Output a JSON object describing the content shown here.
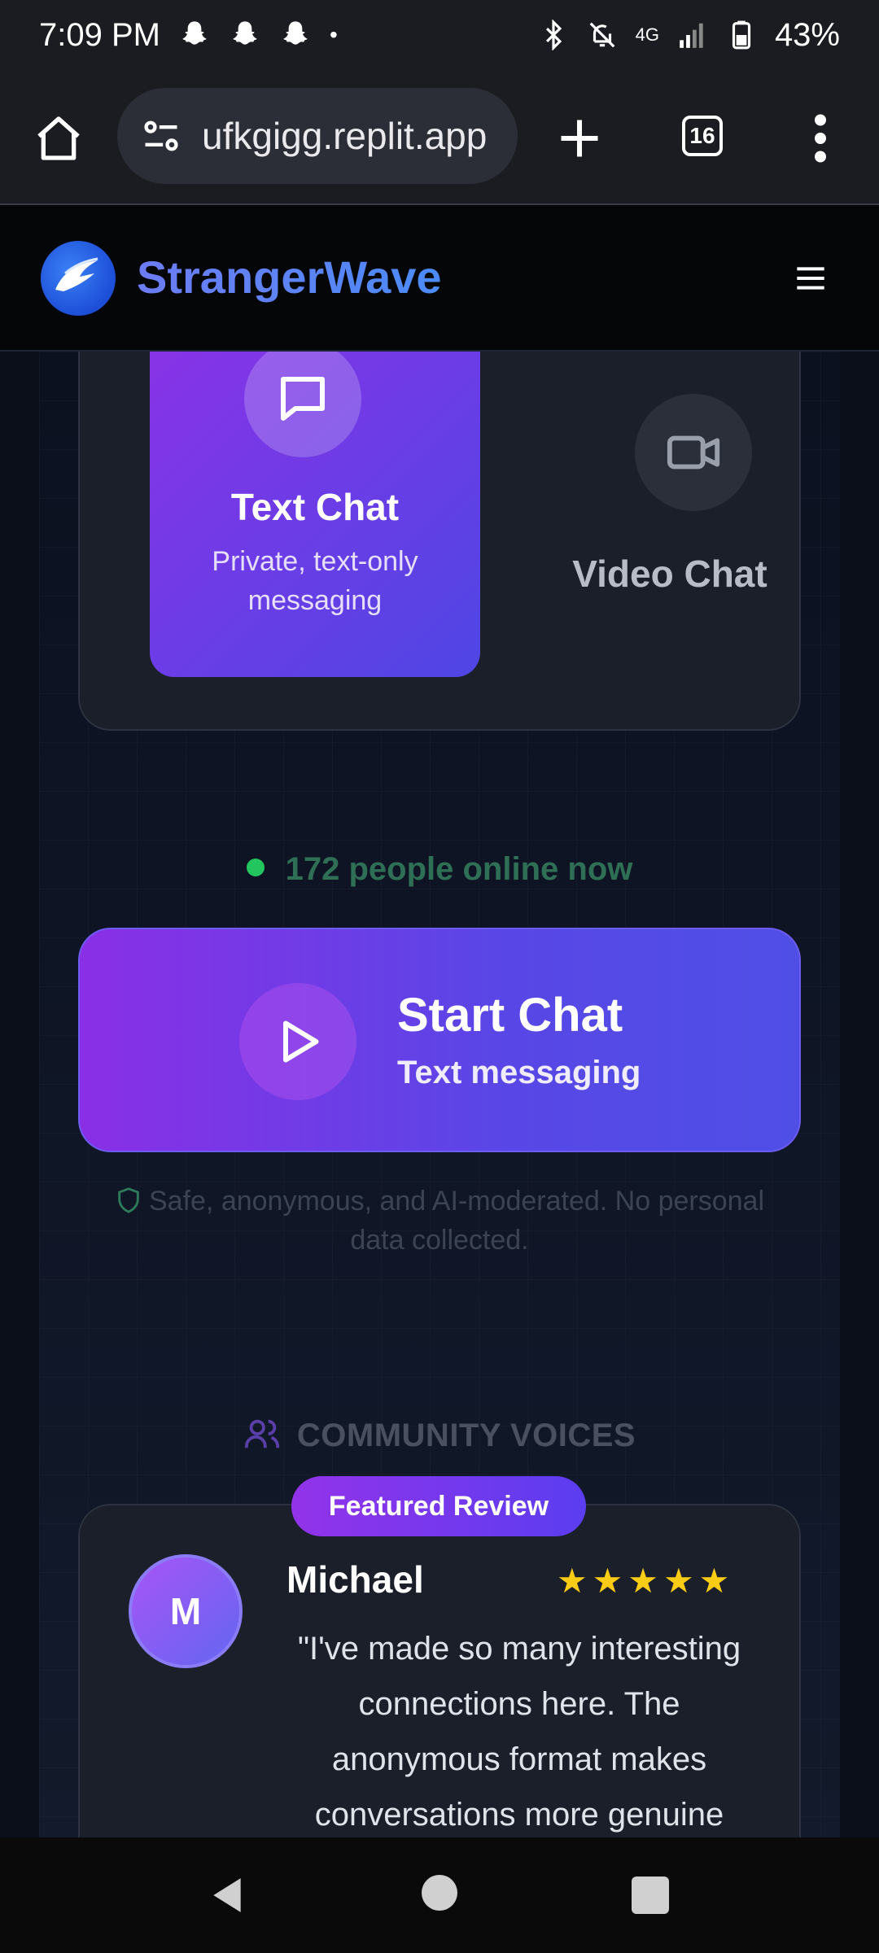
{
  "status_bar": {
    "time": "7:09 PM",
    "notification_icons": [
      "snapchat-icon",
      "snapchat-icon",
      "snapchat-icon"
    ],
    "overflow_dot": "•",
    "network": "4G",
    "battery": "43%"
  },
  "browser": {
    "url": "ufkgigg.replit.app",
    "tab_count": "16"
  },
  "site": {
    "brand": "StrangerWave"
  },
  "modes": {
    "text_chat": {
      "title": "Text Chat",
      "subtitle": "Private, text-only messaging"
    },
    "video_chat": {
      "title": "Video Chat"
    }
  },
  "online_status": "172 people online now",
  "start_button": {
    "label": "Start Chat",
    "sublabel": "Text messaging"
  },
  "safety_note": "Safe, anonymous, and AI-moderated. No personal data collected.",
  "community": {
    "heading": "COMMUNITY VOICES",
    "badge": "Featured Review",
    "review": {
      "avatar_initial": "M",
      "name": "Michael",
      "rating": 5,
      "stars": "★★★★★",
      "quote": "\"I've made so many interesting connections here. The anonymous format makes conversations more genuine"
    }
  },
  "colors": {
    "accent_purple": "#8b32e6",
    "accent_indigo": "#4f46e5",
    "online_green": "#22c55e",
    "star_yellow": "#facc15"
  }
}
